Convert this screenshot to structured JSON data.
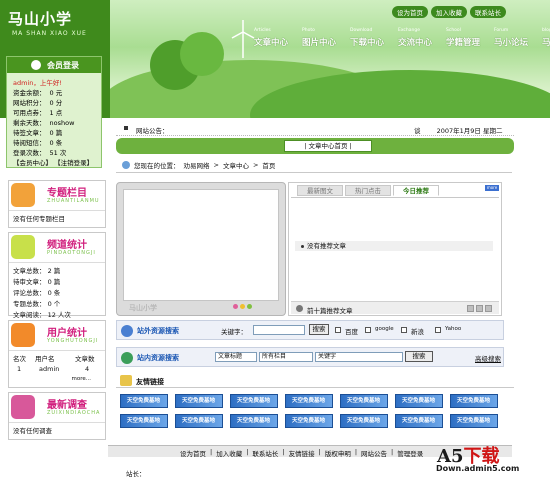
{
  "header": {
    "logo_title": "马山小学",
    "logo_sub": "MA SHAN XIAO XUE",
    "top_links": [
      "设为首页",
      "加入收藏",
      "联系站长"
    ],
    "nav": [
      {
        "en": "Articles",
        "cn": "文章中心"
      },
      {
        "en": "Photo",
        "cn": "图片中心"
      },
      {
        "en": "Download",
        "cn": "下载中心"
      },
      {
        "en": "Exchange",
        "cn": "交流中心"
      },
      {
        "en": "School",
        "cn": "学籍管理"
      },
      {
        "en": "Forum",
        "cn": "马小论坛"
      },
      {
        "en": "blog",
        "cn": "马小博客"
      }
    ]
  },
  "login": {
    "title": "会员登录",
    "user": "admin，上午好!",
    "rows": [
      {
        "label": "资金余额：",
        "value": "0 元"
      },
      {
        "label": "网站积分：",
        "value": "0 分"
      },
      {
        "label": "可用点券：",
        "value": "1 点"
      },
      {
        "label": "剩余天数：",
        "value": "noshow"
      },
      {
        "label": "待签文章：",
        "value": "0 篇"
      },
      {
        "label": "待阅短信：",
        "value": "0 条"
      },
      {
        "label": "登录次数：",
        "value": "51 次"
      }
    ],
    "links": "【会员中心】 【注销登录】"
  },
  "sidebar": {
    "topics": {
      "title": "专题栏目",
      "sub": "ZHUANTILANMU",
      "body": "没有任何专题栏目"
    },
    "stats": {
      "title": "频道统计",
      "sub": "PINDAOTONGJI",
      "rows": [
        {
          "label": "文章总数：",
          "value": "2 篇"
        },
        {
          "label": "待审文章：",
          "value": "0 篇"
        },
        {
          "label": "评论总数：",
          "value": "0 条"
        },
        {
          "label": "专题总数：",
          "value": "0 个"
        },
        {
          "label": "文章阅读：",
          "value": "12 人次"
        }
      ]
    },
    "users": {
      "title": "用户统计",
      "sub": "YONGHUTONGJI",
      "headers": [
        "名次",
        "用户名",
        "文章数"
      ],
      "row": [
        "1",
        "admin",
        "4"
      ],
      "more": "more..."
    },
    "survey": {
      "title": "最新调查",
      "sub": "ZUIXINDIAOCHA",
      "body": "没有任何调查"
    }
  },
  "notice": {
    "label": "网站公告：",
    "right_prefix": "谈",
    "date": "2007年1月9日 星期二"
  },
  "section_tab": "| 文章中心首页 |",
  "breadcrumb": {
    "prefix": "您现在的位置：",
    "items": [
      "劝易网络",
      ">",
      "文章中心",
      ">",
      "首页"
    ]
  },
  "slide": {
    "logo": "马山小学"
  },
  "tabs": {
    "items": [
      "最新图文",
      "热门点击",
      "今日推荐"
    ],
    "more": "more",
    "article": "没有推荐文章",
    "footer": "前十篇推荐文章"
  },
  "outer_search": {
    "title": "站外资源搜索",
    "keyword_label": "关键字：",
    "button": "搜索",
    "engines": [
      "百度",
      "google",
      "新浪",
      "Yahoo"
    ]
  },
  "inner_search": {
    "title": "站内资源搜索",
    "field1": "文章标题",
    "field2": "所有栏目",
    "keyword": "关键字",
    "button": "搜索",
    "advanced": "高级搜索"
  },
  "friends": {
    "title": "友情链接",
    "banner_text": "天空免费基地"
  },
  "footer": {
    "links": [
      "设为首页",
      "|",
      "加入收藏",
      "|",
      "联系站长",
      "|",
      "友情链接",
      "|",
      "版权申明",
      "|",
      "网站公告",
      "|",
      "管理登录"
    ],
    "left": "站长："
  },
  "watermark": {
    "brand_a": "A5",
    "brand_b": "下载",
    "url": "Down.admin5.com"
  },
  "colors": {
    "brand_green": "#4a951f",
    "nav_text": "#ffffff",
    "sidebar_title": "#d11f7d",
    "search_blue": "#1c58b4"
  }
}
